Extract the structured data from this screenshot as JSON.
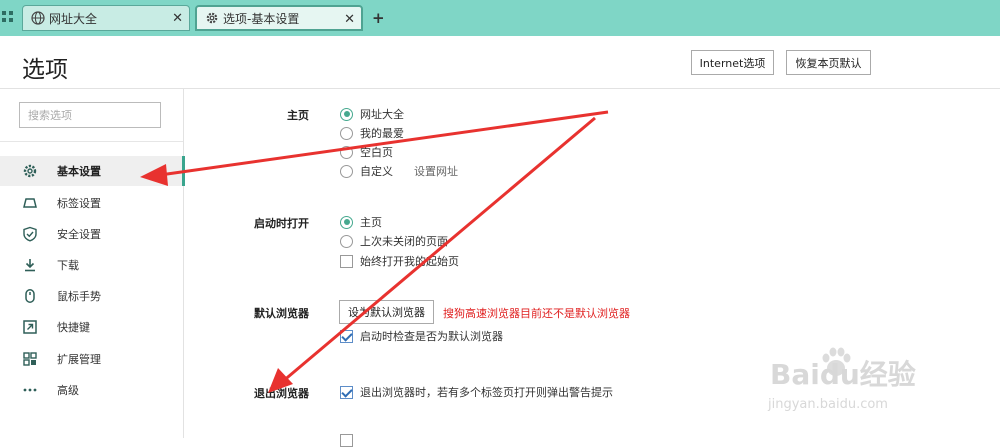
{
  "tabs": [
    {
      "label": "网址大全",
      "icon": "globe-icon",
      "active": false
    },
    {
      "label": "选项-基本设置",
      "icon": "gear-icon",
      "active": true
    }
  ],
  "new_tab_label": "+",
  "header": {
    "title": "选项",
    "internet_options_label": "Internet选项",
    "restore_default_label": "恢复本页默认"
  },
  "sidebar": {
    "search_placeholder": "搜索选项",
    "items": [
      {
        "label": "基本设置",
        "icon": "gear-icon",
        "selected": true
      },
      {
        "label": "标签设置",
        "icon": "tab-icon"
      },
      {
        "label": "安全设置",
        "icon": "shield-icon"
      },
      {
        "label": "下载",
        "icon": "download-icon"
      },
      {
        "label": "鼠标手势",
        "icon": "mouse-icon"
      },
      {
        "label": "快捷键",
        "icon": "shortcut-icon"
      },
      {
        "label": "扩展管理",
        "icon": "extensions-icon"
      },
      {
        "label": "高级",
        "icon": "more-icon"
      }
    ]
  },
  "homepage": {
    "label": "主页",
    "options": [
      "网址大全",
      "我的最爱",
      "空白页",
      "自定义"
    ],
    "selected": "网址大全",
    "set_url_label": "设置网址"
  },
  "startup": {
    "label": "启动时打开",
    "options": [
      "主页",
      "上次未关闭的页面"
    ],
    "selected": "主页",
    "always_open_start_label": "始终打开我的起始页",
    "always_open_start_checked": false
  },
  "default_browser": {
    "label": "默认浏览器",
    "button_label": "设为默认浏览器",
    "warning": "搜狗高速浏览器目前还不是默认浏览器",
    "check_on_startup_label": "启动时检查是否为默认浏览器",
    "check_on_startup_checked": true
  },
  "exit_browser": {
    "label": "退出浏览器",
    "warn_multi_tabs_label": "退出浏览器时，若有多个标签页打开则弹出警告提示",
    "warn_multi_tabs_checked": true
  },
  "watermark": {
    "brand": "Baidu经验",
    "url": "jingyan.baidu.com"
  },
  "colors": {
    "tabbar": "#7fd6c6",
    "accent": "#3aa58e",
    "warning": "#e02020",
    "arrow": "#e8322f"
  }
}
